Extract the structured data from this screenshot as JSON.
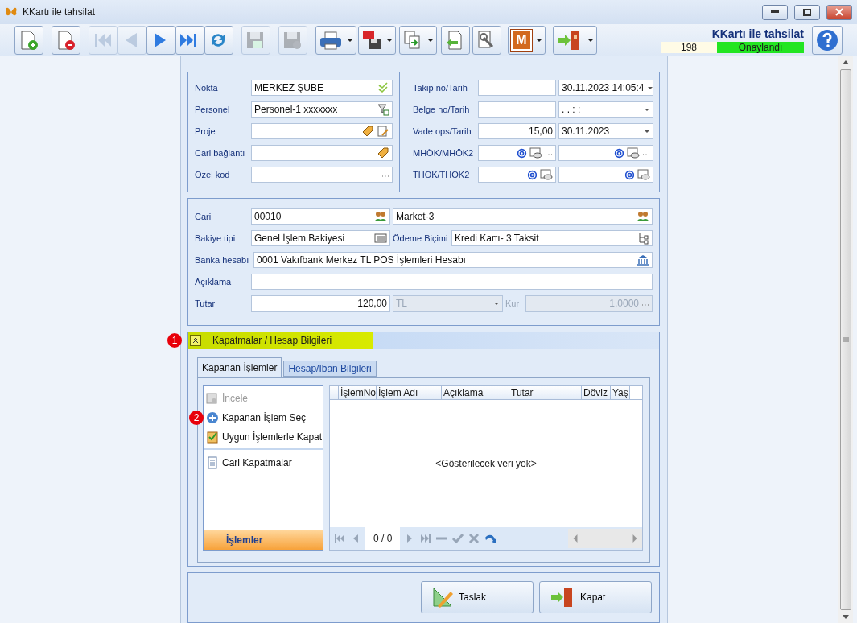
{
  "window": {
    "title": "KKartı ile tahsilat"
  },
  "toolbar": [
    {
      "disabled": false,
      "dropdown": false
    },
    {
      "disabled": false,
      "dropdown": false
    },
    {
      "disabled": true,
      "dropdown": false
    },
    {
      "disabled": true,
      "dropdown": false
    },
    {
      "disabled": false,
      "dropdown": false
    },
    {
      "disabled": false,
      "dropdown": false
    },
    {
      "disabled": false,
      "dropdown": false
    },
    {
      "disabled": true,
      "dropdown": false
    },
    {
      "disabled": true,
      "dropdown": false
    },
    {
      "disabled": false,
      "dropdown": true
    },
    {
      "disabled": false,
      "dropdown": true
    },
    {
      "disabled": false,
      "dropdown": true
    },
    {
      "disabled": false,
      "dropdown": false
    },
    {
      "disabled": false,
      "dropdown": false
    },
    {
      "disabled": false,
      "dropdown": true,
      "text": "M"
    },
    {
      "disabled": false,
      "dropdown": true
    }
  ],
  "header": {
    "title": "KKartı ile tahsilat",
    "number": "198",
    "status": "Onaylandı"
  },
  "general_left": [
    {
      "label": "Nokta",
      "value": "MERKEZ ŞUBE"
    },
    {
      "label": "Personel",
      "value": "Personel-1 xxxxxxx"
    },
    {
      "label": "Proje"
    },
    {
      "label": "Cari bağlantı"
    },
    {
      "label": "Özel kod"
    }
  ],
  "general_right": [
    {
      "label": "Takip no/Tarih",
      "fields": [
        {
          "kind": "text"
        },
        {
          "value": "30.11.2023 14:05:4",
          "kind": "combo"
        }
      ]
    },
    {
      "label": "Belge no/Tarih",
      "fields": [
        {
          "kind": "text"
        },
        {
          "value": ".  .       :  :",
          "kind": "combo"
        }
      ]
    },
    {
      "label": "Vade ops/Tarih",
      "fields": [
        {
          "value": "15,00",
          "kind": "number"
        },
        {
          "value": "30.11.2023",
          "kind": "combo"
        }
      ]
    },
    {
      "label": "MHÖK/MHÖK2",
      "fields": [
        {
          "kind": "email-more"
        },
        {
          "kind": "email-more"
        }
      ]
    },
    {
      "label": "THÖK/THÖK2",
      "fields": [
        {
          "kind": "email"
        },
        {
          "kind": "email"
        }
      ]
    }
  ],
  "account": {
    "cari_label": "Cari",
    "cari_code": "00010",
    "cari_name": "Market-3",
    "balance_label": "Bakiye tipi",
    "balance": "Genel İşlem Bakiyesi",
    "payment_label": "Ödeme Biçimi",
    "payment": "Kredi Kartı- 3 Taksit",
    "bank_label": "Banka hesabı",
    "bank": "0001 Vakıfbank Merkez TL POS İşlemleri Hesabı",
    "note_label": "Açıklama",
    "amount_label": "Tutar",
    "amount": "120,00",
    "currency": "TL",
    "currency_disabled": true,
    "rate_label": "Kur",
    "rate": "1,0000",
    "rate_disabled": true
  },
  "section": {
    "title": "Kapatmalar / Hesap Bilgileri",
    "callout": "1",
    "expanded": true
  },
  "tabs": [
    {
      "label": "Kapanan İşlemler",
      "selected": true
    },
    {
      "label": "Hesap/Iban Bilgileri",
      "selected": false
    }
  ],
  "action_groups": [
    [
      {
        "label": "İncele",
        "disabled": true
      },
      {
        "label": "Kapanan İşlem Seç",
        "disabled": false,
        "callout": "2"
      },
      {
        "label": "Uygun İşlemlerle Kapat",
        "disabled": false
      }
    ],
    [
      {
        "label": "Cari Kapatmalar",
        "disabled": false
      }
    ]
  ],
  "actions_footer": "İşlemler",
  "grid": {
    "columns": [
      "İşlemNo",
      "İşlem Adı",
      "Açıklama",
      "Tutar",
      "Döviz",
      "Yaş"
    ],
    "empty_text": "<Gösterilecek veri yok>",
    "position": "0 / 0"
  },
  "buttons": [
    {
      "label": "Taslak"
    },
    {
      "label": "Kapat"
    }
  ]
}
